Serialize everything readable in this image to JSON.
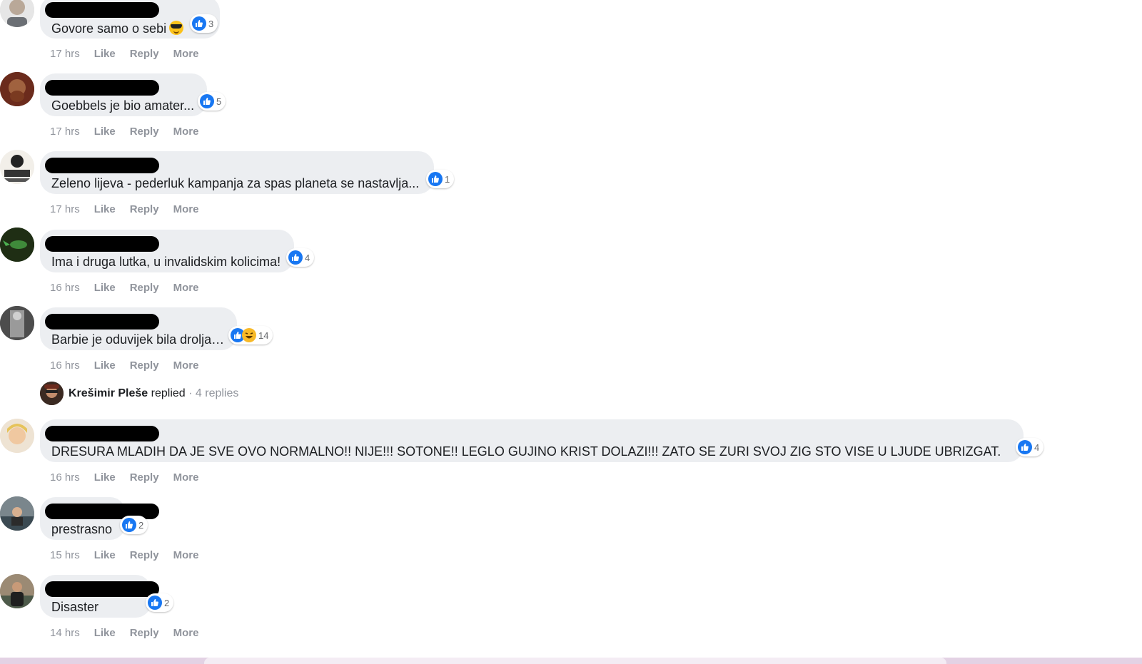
{
  "actions": {
    "like": "Like",
    "reply": "Reply",
    "more": "More"
  },
  "comments": [
    {
      "text": "Govore samo o sebi",
      "time": "17 hrs",
      "reactions": "3"
    },
    {
      "text": "Goebbels je bio amater...",
      "time": "17 hrs",
      "reactions": "5"
    },
    {
      "text": "Zeleno lijeva - pederluk kampanja za spas planeta se nastavlja...",
      "time": "17 hrs",
      "reactions": "1"
    },
    {
      "text": "Ima i druga lutka, u invalidskim kolicima!",
      "time": "16 hrs",
      "reactions": "4"
    },
    {
      "text": "Barbie je oduvijek bila drolja…",
      "time": "16 hrs",
      "reactions": "14"
    },
    {
      "text": "DRESURA MLADIH DA JE SVE OVO NORMALNO!! NIJE!!! SOTONE!! LEGLO GUJINO KRIST DOLAZI!!! ZATO SE ZURI SVOJ ZIG STO VISE U LJUDE UBRIZGAT.",
      "time": "16 hrs",
      "reactions": "4"
    },
    {
      "text": "prestrasno",
      "time": "15 hrs",
      "reactions": "2"
    },
    {
      "text": "Disaster",
      "time": "14 hrs",
      "reactions": "2"
    }
  ],
  "replied": {
    "name": "Krešimir Pleše",
    "word": "replied",
    "count": "· 4 replies"
  },
  "colors": {
    "like_blue": "#1877f2",
    "bubble_gray": "#eceef1",
    "action_gray": "#90949c"
  },
  "icons": [
    "profile-avatar",
    "like-icon",
    "haha-icon",
    "sunglasses-emoji"
  ]
}
